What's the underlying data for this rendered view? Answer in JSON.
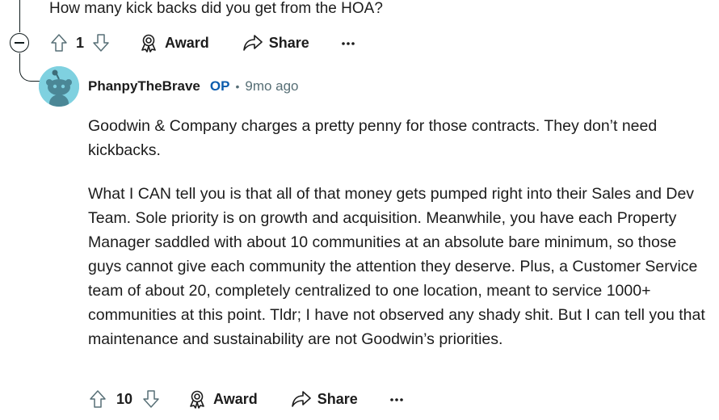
{
  "parent_comment": {
    "text": "How many kick backs did you get from the HOA?",
    "votes": "1",
    "award_label": "Award",
    "share_label": "Share"
  },
  "reply": {
    "author": "PhanpyTheBrave",
    "op_badge": "OP",
    "separator": "•",
    "timestamp": "9mo ago",
    "paragraphs": [
      "Goodwin & Company charges a pretty penny for those contracts. They don’t need kickbacks.",
      "What I CAN tell you is that all of that money gets pumped right into their Sales and Dev Team. Sole priority is on growth and acquisition. Meanwhile, you have each Property Manager saddled with about 10 communities at an absolute bare minimum, so those guys cannot give each community the attention they deserve. Plus, a Customer Service team of about 20, completely centralized to one location, meant to service 1000+ communities at this point. Tldr; I have not observed any shady shit. But I can tell you that maintenance and sustainability are not Goodwin’s priorities."
    ],
    "votes": "10",
    "award_label": "Award",
    "share_label": "Share"
  },
  "icons": {
    "collapse": "collapse-icon",
    "upvote": "upvote-arrow-icon",
    "downvote": "downvote-arrow-icon",
    "award": "award-ribbon-icon",
    "share": "share-arrow-icon",
    "more": "more-dots-icon",
    "avatar": "snoo-avatar"
  },
  "colors": {
    "text": "#1c1c1c",
    "op_badge": "#0b5cad",
    "meta": "#576f76",
    "avatar_bg": "#7fd1e0"
  }
}
